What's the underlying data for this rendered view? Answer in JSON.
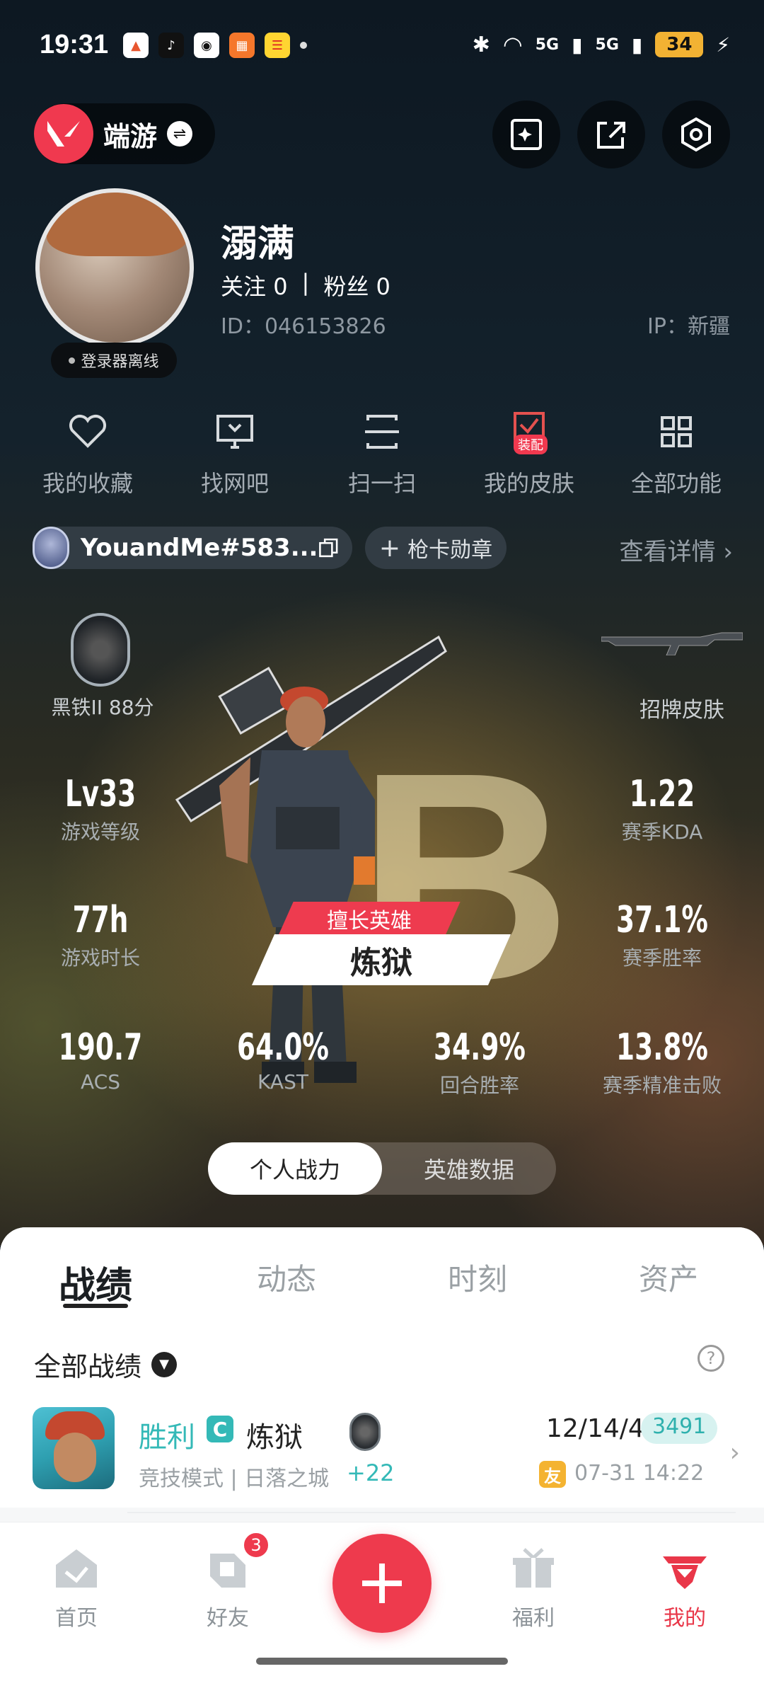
{
  "status_bar": {
    "time": "19:31",
    "network_1": "5G",
    "network_2": "5G",
    "battery": "34"
  },
  "header": {
    "game_name": "端游"
  },
  "profile": {
    "nickname": "溺满",
    "follow_label": "关注",
    "follow_count": "0",
    "fans_label": "粉丝",
    "fans_count": "0",
    "separator": "|",
    "id_text": "ID：046153826",
    "ip_text": "IP：新疆",
    "status_badge": "登录器离线"
  },
  "quick_menu": [
    {
      "label": "我的收藏",
      "icon": "heart-icon"
    },
    {
      "label": "找网吧",
      "icon": "monitor-icon"
    },
    {
      "label": "扫一扫",
      "icon": "scan-icon"
    },
    {
      "label": "我的皮肤",
      "icon": "skin-icon",
      "tag": "装配"
    },
    {
      "label": "全部功能",
      "icon": "grid-icon"
    }
  ],
  "account": {
    "name": "YouandMe#583...",
    "badge_button": "枪卡勋章",
    "detail_link": "查看详情"
  },
  "stats": {
    "rank_label": "黑铁II 88分",
    "skin_label": "招牌皮肤",
    "level": {
      "value": "Lv33",
      "label": "游戏等级"
    },
    "kda": {
      "value": "1.22",
      "label": "赛季KDA"
    },
    "play_time": {
      "value": "77h",
      "label": "游戏时长"
    },
    "win_rate": {
      "value": "37.1%",
      "label": "赛季胜率"
    },
    "acs": {
      "value": "190.7",
      "label": "ACS"
    },
    "kast": {
      "value": "64.0%",
      "label": "KAST"
    },
    "round_win": {
      "value": "34.9%",
      "label": "回合胜率"
    },
    "precision": {
      "value": "13.8%",
      "label": "赛季精准击败"
    },
    "grade_letter": "B",
    "favorite_tag": "擅长英雄",
    "favorite_agent": "炼狱"
  },
  "view_toggle": {
    "active": "个人战力",
    "inactive": "英雄数据"
  },
  "tabs": [
    "战绩",
    "动态",
    "时刻",
    "资产"
  ],
  "records": {
    "filter": "全部战绩",
    "match": {
      "result": "胜利",
      "tier_tag": "C",
      "agent": "炼狱",
      "mode": "竞技模式 | 日落之城",
      "delta": "+22",
      "kda": "12/14/4",
      "score": "3491",
      "friend_tag": "友",
      "time": "07-31 14:22"
    }
  },
  "bottom_nav": {
    "home": "首页",
    "friends": "好友",
    "friends_badge": "3",
    "welfare": "福利",
    "mine": "我的"
  },
  "colors": {
    "accent": "#ee3a4d",
    "win": "#34b9b7"
  }
}
